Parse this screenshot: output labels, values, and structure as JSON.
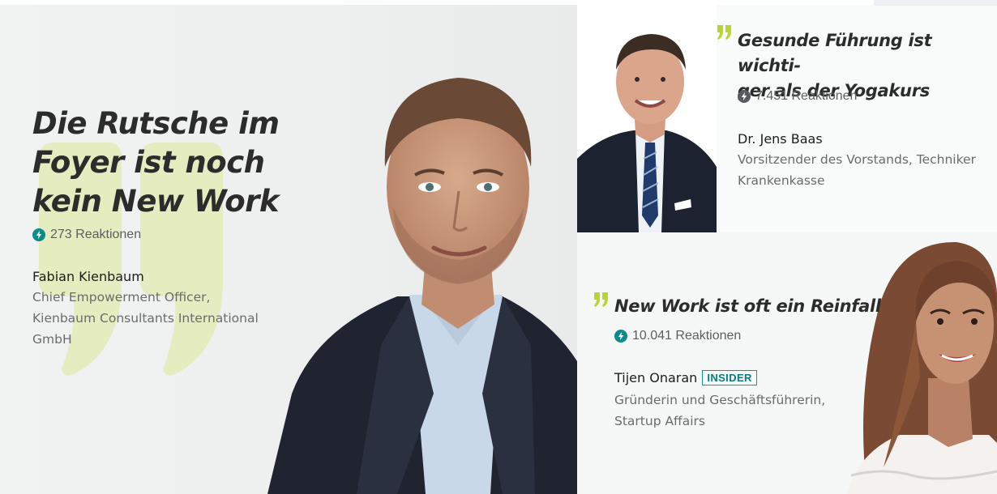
{
  "main": {
    "title_lines": [
      "Die Rutsche im",
      "Foyer ist noch",
      "kein New Work"
    ],
    "reactions": "273 Reaktionen",
    "name": "Fabian Kienbaum",
    "role_lines": [
      "Chief Empowerment Officer,",
      "Kienbaum Consultants International",
      "GmbH"
    ]
  },
  "top_right": {
    "title_lines": [
      "Gesunde Führung ist wichti-",
      "ger als der Yogakurs"
    ],
    "reactions": "7.451 Reaktionen",
    "name": "Dr. Jens Baas",
    "role_lines": [
      "Vorsitzender des Vorstands, Techniker",
      "Krankenkasse"
    ]
  },
  "bottom_right": {
    "title": "New Work ist oft ein Reinfall",
    "reactions": "10.041 Reaktionen",
    "name": "Tijen Onaran",
    "badge": "INSIDER",
    "role_lines": [
      "Gründerin und Geschäftsführerin,",
      "Startup Affairs"
    ]
  },
  "icons": {
    "reactions": "lightning-bolt-icon",
    "quote": "quote-mark-icon"
  },
  "colors": {
    "accent_lime": "#b9d531",
    "accent_teal": "#0b8c8c",
    "text_dark": "#2c2c2c",
    "text_muted": "#6b6b6b"
  }
}
